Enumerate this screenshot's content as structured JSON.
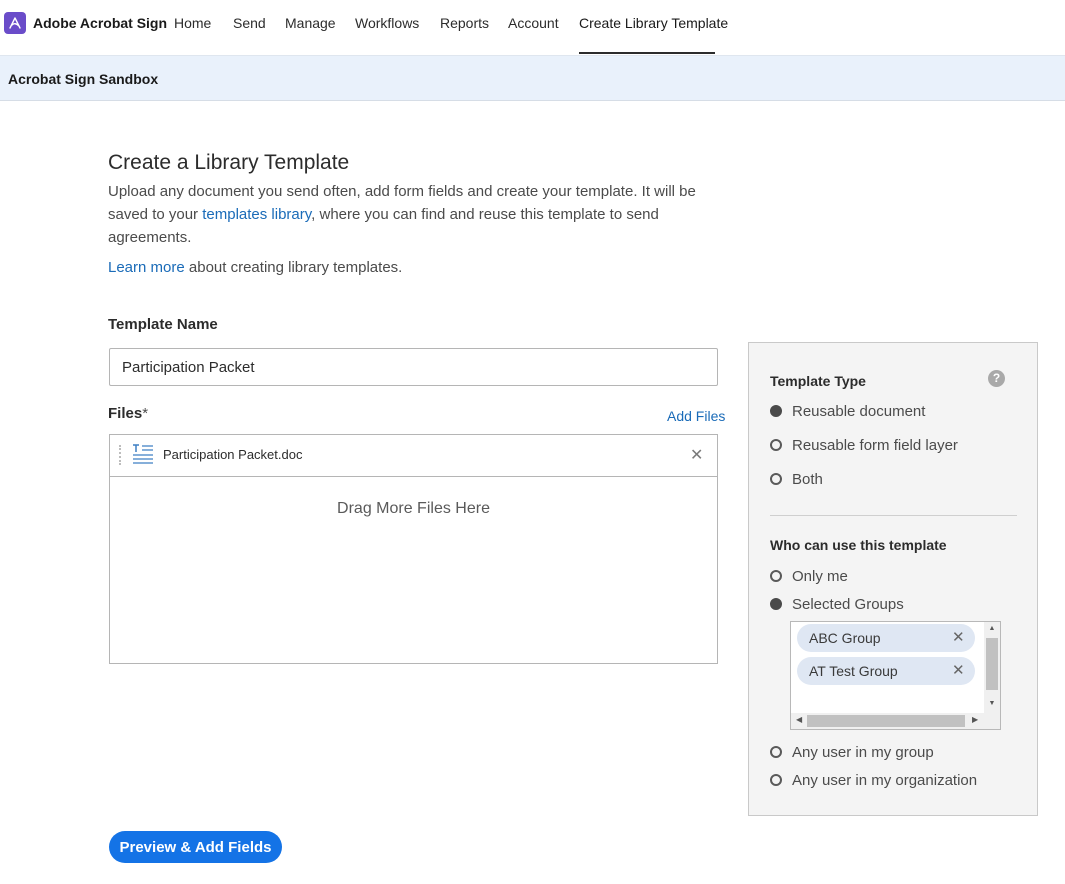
{
  "app": {
    "name": "Adobe Acrobat Sign"
  },
  "nav": {
    "items": [
      {
        "label": "Home"
      },
      {
        "label": "Send"
      },
      {
        "label": "Manage"
      },
      {
        "label": "Workflows"
      },
      {
        "label": "Reports"
      },
      {
        "label": "Account"
      },
      {
        "label": "Create Library Template"
      }
    ],
    "active": "Create Library Template"
  },
  "sandbox": {
    "label": "Acrobat Sign Sandbox"
  },
  "page": {
    "title": "Create a Library Template",
    "intro_before": "Upload any document you send often, add form fields and create your template. It will be saved to your ",
    "intro_link": "templates library",
    "intro_after": ", where you can find and reuse this template to send agreements.",
    "learn_link": "Learn more",
    "learn_after": " about creating library templates."
  },
  "template_name": {
    "label": "Template Name",
    "value": "Participation Packet"
  },
  "files": {
    "label": "Files",
    "required_mark": "*",
    "add_label": "Add Files",
    "items": [
      {
        "name": "Participation Packet.doc"
      }
    ],
    "remove_glyph": "✕",
    "drop_text": "Drag More Files Here"
  },
  "template_type": {
    "title": "Template Type",
    "help_glyph": "?",
    "options": [
      {
        "label": "Reusable document",
        "checked": true
      },
      {
        "label": "Reusable form field layer",
        "checked": false
      },
      {
        "label": "Both",
        "checked": false
      }
    ]
  },
  "who_can_use": {
    "title": "Who can use this template",
    "options": [
      {
        "label": "Only me",
        "checked": false
      },
      {
        "label": "Selected Groups",
        "checked": true
      },
      {
        "label": "Any user in my group",
        "checked": false
      },
      {
        "label": "Any user in my organization",
        "checked": false
      }
    ],
    "groups": [
      {
        "label": "ABC Group"
      },
      {
        "label": "AT Test Group"
      }
    ],
    "remove_glyph": "✕"
  },
  "actions": {
    "primary_label": "Preview & Add Fields"
  },
  "colors": {
    "accent": "#1473e6",
    "link": "#1a6bb8",
    "brand": "#6a4cc9",
    "sandbox_bg": "#e9f1fb",
    "tag_bg": "#dfe7f3"
  }
}
